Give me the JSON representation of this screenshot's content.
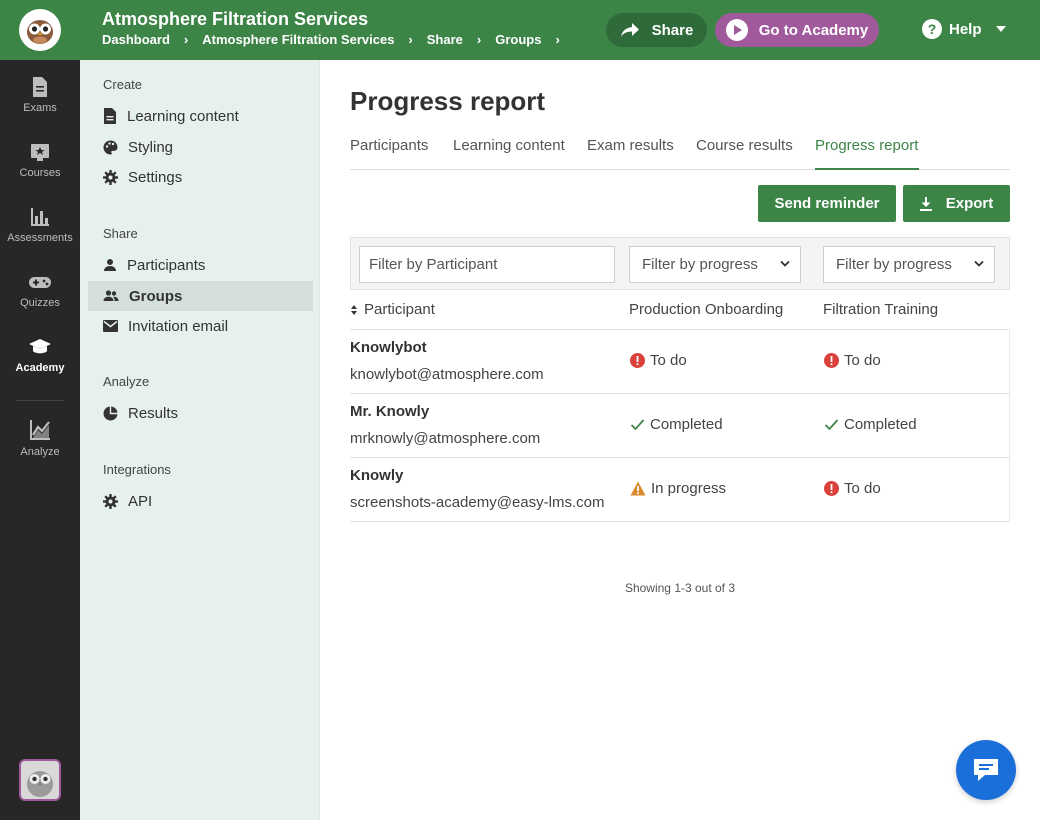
{
  "header": {
    "title": "Atmosphere Filtration Services",
    "breadcrumbs": [
      "Dashboard",
      "Atmosphere Filtration Services",
      "Share",
      "Groups"
    ],
    "share_label": "Share",
    "academy_label": "Go to Academy",
    "help_label": "Help",
    "accent_color": "#3d8447",
    "academy_color": "#a05a9c"
  },
  "rail": {
    "items": [
      {
        "label": "Exams",
        "icon": "document-icon"
      },
      {
        "label": "Courses",
        "icon": "course-icon"
      },
      {
        "label": "Assessments",
        "icon": "bar-chart-icon"
      },
      {
        "label": "Quizzes",
        "icon": "gamepad-icon"
      },
      {
        "label": "Academy",
        "icon": "graduation-cap-icon"
      },
      {
        "label": "Analyze",
        "icon": "line-chart-icon"
      }
    ],
    "active": "Academy"
  },
  "sidebar": {
    "sections": [
      {
        "heading": "Create",
        "items": [
          "Learning content",
          "Styling",
          "Settings"
        ]
      },
      {
        "heading": "Share",
        "items": [
          "Participants",
          "Groups",
          "Invitation email"
        ]
      },
      {
        "heading": "Analyze",
        "items": [
          "Results"
        ]
      },
      {
        "heading": "Integrations",
        "items": [
          "API"
        ]
      }
    ],
    "active": "Groups"
  },
  "main": {
    "title": "Progress report",
    "tabs": [
      "Participants",
      "Learning content",
      "Exam results",
      "Course results",
      "Progress report"
    ],
    "active_tab": "Progress report",
    "send_reminder_label": "Send reminder",
    "export_label": "Export",
    "filters": {
      "participant_placeholder": "Filter by Participant",
      "progress_1": "Filter by progress",
      "progress_2": "Filter by progress"
    },
    "columns": [
      "Participant",
      "Production Onboarding",
      "Filtration Training"
    ],
    "rows": [
      {
        "name": "Knowlybot",
        "email": "knowlybot@atmosphere.com",
        "production": "To do",
        "filtration": "To do"
      },
      {
        "name": "Mr. Knowly",
        "email": "mrknowly@atmosphere.com",
        "production": "Completed",
        "filtration": "Completed"
      },
      {
        "name": "Knowly",
        "email": "screenshots-academy@easy-lms.com",
        "production": "In progress",
        "filtration": "To do"
      }
    ],
    "showing": "Showing 1-3 out of 3"
  },
  "status_colors": {
    "todo": "#d9413a",
    "completed": "#3d8447",
    "in_progress": "#d98a2b"
  }
}
